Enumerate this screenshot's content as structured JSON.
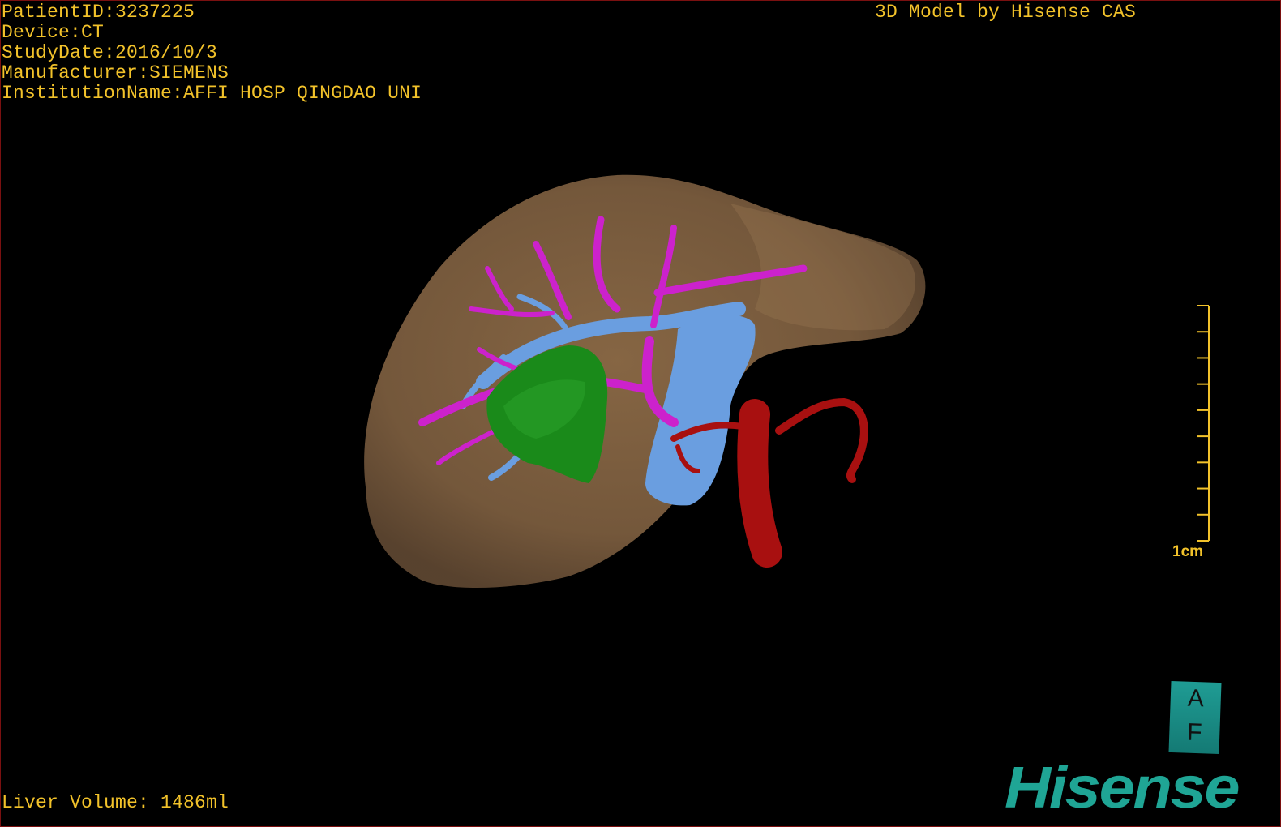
{
  "info": {
    "patient_id": "PatientID:3237225",
    "device": "Device:CT",
    "study_date": "StudyDate:2016/10/3",
    "manufacturer": "Manufacturer:SIEMENS",
    "institution": "InstitutionName:AFFI HOSP QINGDAO UNI"
  },
  "credit": "3D Model by Hisense CAS",
  "liver_volume": "Liver Volume: 1486ml",
  "scale_bar": {
    "label": "1cm",
    "ticks": 10
  },
  "orientation_cube": {
    "top": "A",
    "bottom": "F"
  },
  "logo": "Hisense",
  "colors": {
    "overlay_text": "#f2c22a",
    "liver": "#8a6a48",
    "portal_vein": "#6a9ee0",
    "hepatic_artery_branches": "#cc22cc",
    "tumor": "#1a8a1a",
    "artery": "#a81010",
    "brand": "#1fa595",
    "border": "#7a1010"
  }
}
